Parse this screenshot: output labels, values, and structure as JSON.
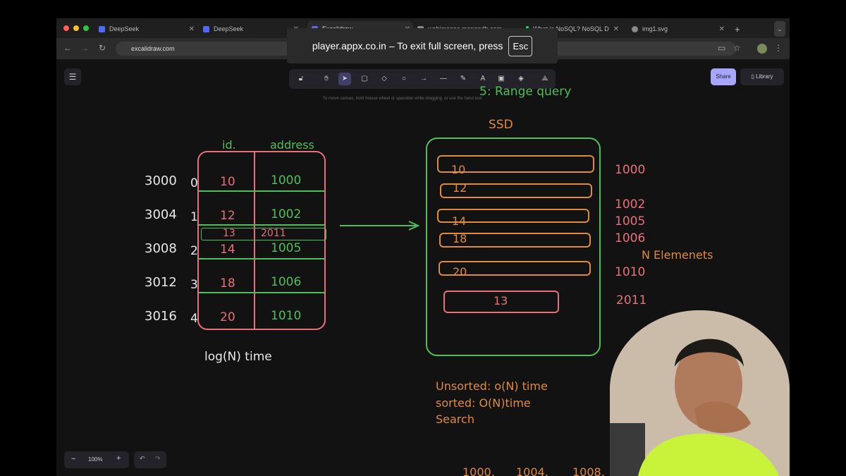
{
  "browser": {
    "tabs": [
      {
        "label": "DeepSeek",
        "color": "#4d6bfe"
      },
      {
        "label": "DeepSeek",
        "color": "#4d6bfe"
      },
      {
        "label": "Excalidraw",
        "color": "#6965db"
      },
      {
        "label": "webimages.mongodb.com",
        "color": "#888888"
      },
      {
        "label": "What is NoSQL? NoSQL D",
        "color": "#00ed64"
      },
      {
        "label": "img1.svg",
        "color": "#888888"
      }
    ],
    "url": "excalidraw.com"
  },
  "fullscreen_banner": {
    "text": "player.appx.co.in – To exit full screen, press",
    "key": "Esc"
  },
  "excalidraw": {
    "share_label": "Share",
    "library_label": "Library",
    "hint": "To move canvas, hold mouse wheel or spacebar while dragging, or use the hand tool",
    "zoom": "100%"
  },
  "drawing": {
    "range_query": "5: Range query",
    "col_id": "id.",
    "col_address": "address",
    "memory_addresses": [
      "3000",
      "3004",
      "3008",
      "3012",
      "3016"
    ],
    "row_indices": [
      "0",
      "1",
      "2",
      "3",
      "4"
    ],
    "ids": [
      "10",
      "12",
      "14",
      "18",
      "20"
    ],
    "addresses": [
      "1000",
      "1002",
      "1005",
      "1006",
      "1010"
    ],
    "inserted_id": "13",
    "inserted_address": "2011",
    "log_time": "log(N) time",
    "ssd_label": "SSD",
    "ssd_values": [
      "10",
      "12",
      "14",
      "18",
      "20",
      "13"
    ],
    "ssd_addresses": [
      "1000",
      "1002",
      "1005",
      "1006",
      "1010",
      "2011"
    ],
    "n_elements": "N Elemenets",
    "unsorted": "Unsorted: o(N) time",
    "sorted": "sorted: O(N)time",
    "search": "Search",
    "bottom_values": [
      "1000,",
      "1004,",
      "1008,"
    ]
  },
  "colors": {
    "pink": "#e8707a",
    "green": "#4fbf5a",
    "orange": "#e08a3c",
    "white": "#e8e8e8"
  }
}
